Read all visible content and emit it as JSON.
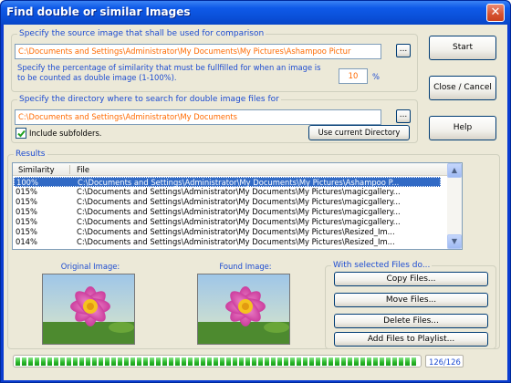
{
  "window": {
    "title": "Find double or similar Images",
    "close_glyph": "✕"
  },
  "source_group": {
    "label": "Specify the source image that shall be used for comparison",
    "path_value": "C:\\Documents and Settings\\Administrator\\My Documents\\My Pictures\\Ashampoo Pictur",
    "browse_label": "...",
    "percentage_prompt": "Specify the percentage of similarity that must be fullfilled for when an image is to be counted as double image (1-100%).",
    "percentage_value": "10",
    "percent_unit": "%"
  },
  "directory_group": {
    "label": "Specify the directory where to search for double image files for",
    "path_value": "C:\\Documents and Settings\\Administrator\\My Documents",
    "browse_label": "...",
    "include_subfolders_label": "Include subfolders.",
    "include_subfolders_checked": true,
    "use_current_label": "Use current Directory"
  },
  "side_buttons": {
    "start": "Start",
    "close_cancel": "Close / Cancel",
    "help": "Help"
  },
  "results": {
    "label": "Results",
    "columns": [
      "Similarity",
      "File"
    ],
    "rows": [
      {
        "similarity": "100%",
        "file": "C:\\Documents and Settings\\Administrator\\My Documents\\My Pictures\\Ashampoo P...",
        "selected": true
      },
      {
        "similarity": "015%",
        "file": "C:\\Documents and Settings\\Administrator\\My Documents\\My Pictures\\magicgallery...",
        "selected": false
      },
      {
        "similarity": "015%",
        "file": "C:\\Documents and Settings\\Administrator\\My Documents\\My Pictures\\magicgallery...",
        "selected": false
      },
      {
        "similarity": "015%",
        "file": "C:\\Documents and Settings\\Administrator\\My Documents\\My Pictures\\magicgallery...",
        "selected": false
      },
      {
        "similarity": "015%",
        "file": "C:\\Documents and Settings\\Administrator\\My Documents\\My Pictures\\magicgallery...",
        "selected": false
      },
      {
        "similarity": "015%",
        "file": "C:\\Documents and Settings\\Administrator\\My Documents\\My Pictures\\Resized_Im...",
        "selected": false
      },
      {
        "similarity": "014%",
        "file": "C:\\Documents and Settings\\Administrator\\My Documents\\My Pictures\\Resized_Im...",
        "selected": false
      }
    ]
  },
  "preview": {
    "original_label": "Original Image:",
    "found_label": "Found Image:"
  },
  "actions": {
    "label": "With selected Files do...",
    "copy": "Copy Files...",
    "move": "Move Files...",
    "delete": "Delete Files...",
    "add_playlist": "Add Files to Playlist..."
  },
  "progress": {
    "fraction": 1.0,
    "counter_text": "126/126"
  },
  "colors": {
    "titlebar": "#0a4fd8",
    "dialog_bg": "#ece9d8",
    "label_blue": "#1d4cd1",
    "path_orange": "#ff6a00",
    "selection": "#316ac5",
    "progress_green": "#29b729"
  },
  "icons": {
    "title_icon": "app-icon",
    "close": "close-icon",
    "checkbox": "checkmark-icon",
    "scroll_up": "arrow-up-icon",
    "scroll_down": "arrow-down-icon"
  }
}
